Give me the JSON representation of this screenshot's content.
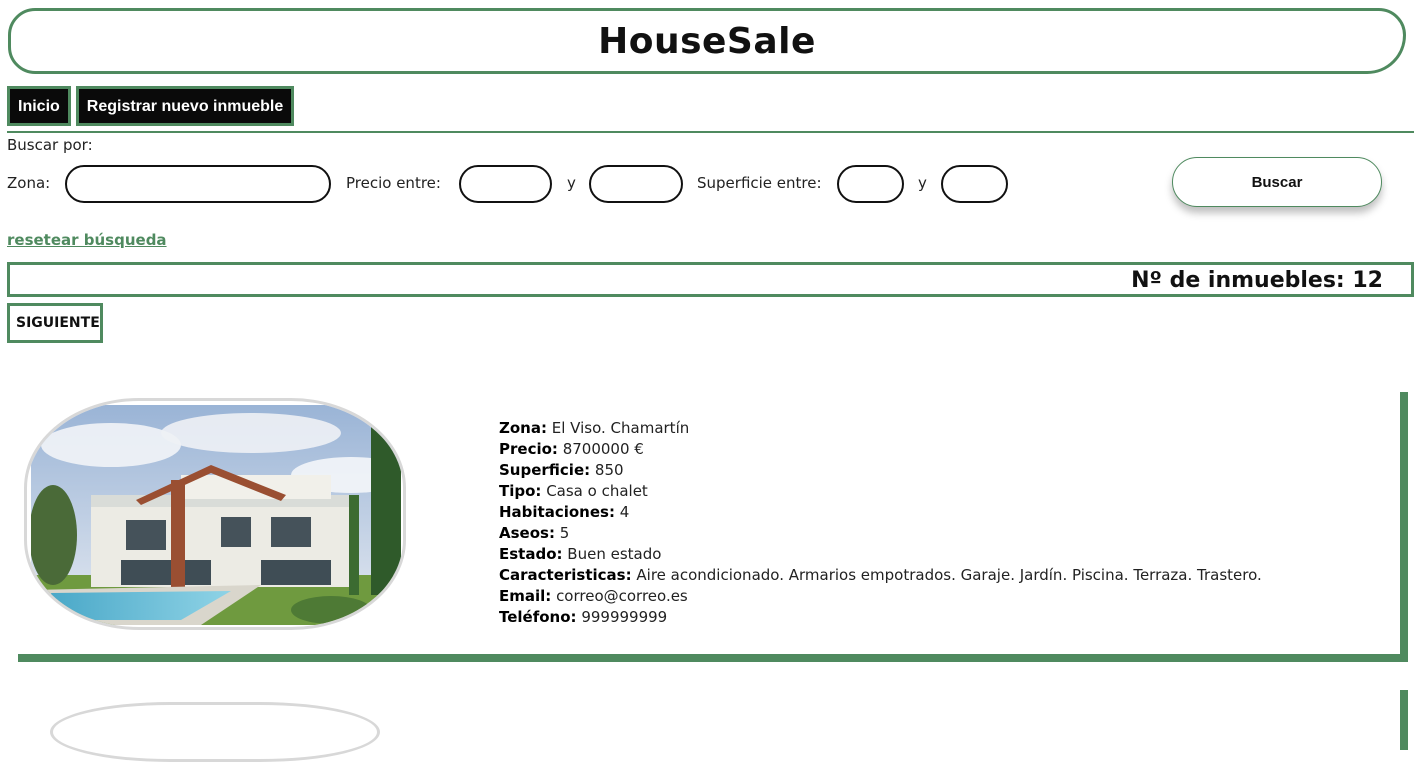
{
  "header": {
    "title": "HouseSale"
  },
  "nav": {
    "items": [
      "Inicio",
      "Registrar nuevo inmueble"
    ]
  },
  "search": {
    "heading": "Buscar por:",
    "zona_label": "Zona:",
    "zona_value": "",
    "precio_label": "Precio entre:",
    "precio_min": "",
    "precio_max": "",
    "y1": "y",
    "superficie_label": "Superficie entre:",
    "superficie_min": "",
    "superficie_max": "",
    "y2": "y",
    "button": "Buscar",
    "reset": "resetear búsqueda"
  },
  "results": {
    "count_text": "Nº de inmuebles: 12",
    "next_button": "SIGUIENTE"
  },
  "listings": [
    {
      "zona_label": "Zona:",
      "zona": "El Viso. Chamartín",
      "precio_label": "Precio:",
      "precio": "8700000 €",
      "superficie_label": "Superficie:",
      "superficie": "850",
      "tipo_label": "Tipo:",
      "tipo": "Casa o chalet",
      "habitaciones_label": "Habitaciones:",
      "habitaciones": "4",
      "aseos_label": "Aseos:",
      "aseos": "5",
      "estado_label": "Estado:",
      "estado": "Buen estado",
      "caracteristicas_label": "Caracteristicas:",
      "caracteristicas": "Aire acondicionado. Armarios empotrados. Garaje. Jardín. Piscina. Terraza. Trastero.",
      "email_label": "Email:",
      "email": "correo@correo.es",
      "telefono_label": "Teléfono:",
      "telefono": "999999999"
    }
  ],
  "colors": {
    "accent": "#4f8a5f",
    "nav_bg": "#0a0a0a"
  }
}
